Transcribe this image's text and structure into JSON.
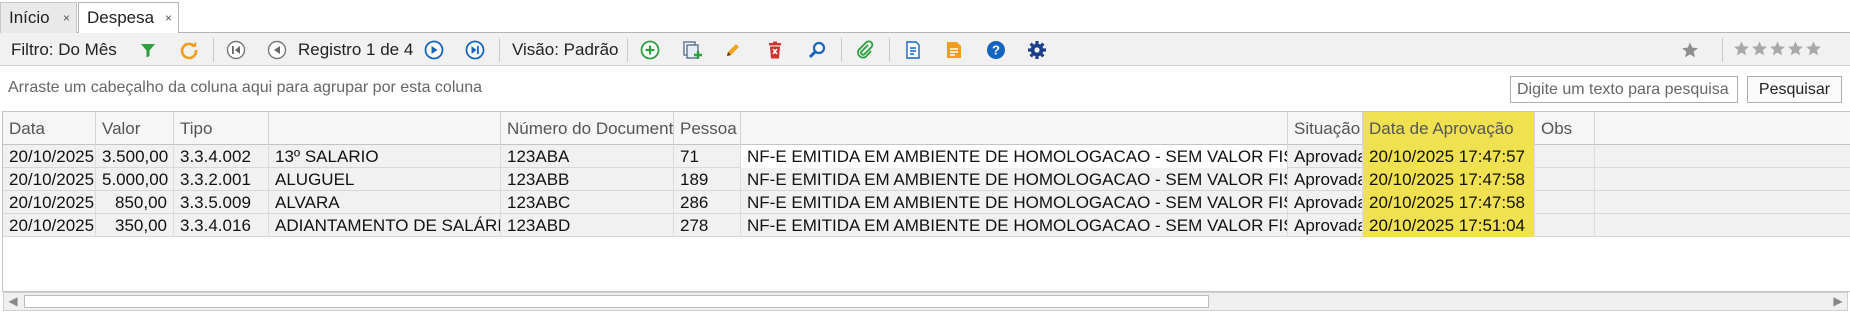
{
  "tabs": [
    {
      "label": "Início",
      "close": "×"
    },
    {
      "label": "Despesa",
      "close": "×"
    }
  ],
  "toolbar": {
    "filter_label": "Filtro: Do Mês",
    "record_label": "Registro 1 de 4",
    "view_label": "Visão: Padrão",
    "stars_total": 5,
    "stars_filled": 0
  },
  "icons": {
    "filter": "funnel-icon",
    "refresh": "refresh-icon",
    "first": "first-record-icon",
    "prev": "previous-record-icon",
    "next": "next-record-icon",
    "last": "last-record-icon",
    "add": "add-icon",
    "duplicate": "duplicate-icon",
    "edit": "pencil-icon",
    "delete": "trash-icon",
    "search": "magnifier-icon",
    "attach": "paperclip-icon",
    "export": "export-document-icon",
    "notes": "notes-icon",
    "help": "help-icon",
    "settings": "gear-icon",
    "favorite": "star-icon",
    "rating": "rating-stars"
  },
  "colors": {
    "highlight": "#f0e150",
    "accent_blue": "#1565c0",
    "green": "#2e9e3e",
    "orange": "#f29d1b",
    "red": "#d32f2f"
  },
  "group": {
    "hint": "Arraste um cabeçalho da coluna aqui para agrupar por esta coluna",
    "search_placeholder": "Digite um texto para pesquisa",
    "search_button": "Pesquisar"
  },
  "grid": {
    "columns": [
      "Data",
      "Valor",
      "Tipo",
      "",
      "Número do Documento",
      "Pessoa",
      "",
      "Situação",
      "Data de Aprovação",
      "Obs"
    ],
    "rows": [
      [
        "20/10/2025",
        "3.500,00",
        "3.3.4.002",
        "13º SALARIO",
        "123ABA",
        "71",
        "NF-E EMITIDA EM AMBIENTE DE HOMOLOGACAO - SEM VALOR FISCAL",
        "Aprovada",
        "20/10/2025 17:47:57",
        ""
      ],
      [
        "20/10/2025",
        "5.000,00",
        "3.3.2.001",
        "ALUGUEL",
        "123ABB",
        "189",
        "NF-E EMITIDA EM AMBIENTE DE HOMOLOGACAO - SEM VALOR FISCAL",
        "Aprovada",
        "20/10/2025 17:47:58",
        ""
      ],
      [
        "20/10/2025",
        "850,00",
        "3.3.5.009",
        "ALVARA",
        "123ABC",
        "286",
        "NF-E EMITIDA EM AMBIENTE DE HOMOLOGACAO - SEM VALOR FISCAL",
        "Aprovada",
        "20/10/2025 17:47:58",
        ""
      ],
      [
        "20/10/2025",
        "350,00",
        "3.3.4.016",
        "ADIANTAMENTO DE SALÁRIO",
        "123ABD",
        "278",
        "NF-E EMITIDA EM AMBIENTE DE HOMOLOGACAO - SEM VALOR FISCAL",
        "Aprovada",
        "20/10/2025 17:51:04",
        ""
      ]
    ]
  },
  "scroll": {
    "left_arrow": "◀",
    "right_arrow": "▶"
  }
}
